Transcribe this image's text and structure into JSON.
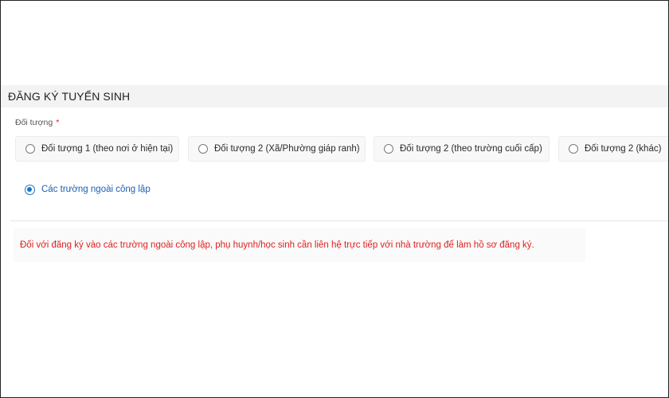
{
  "form": {
    "title": "ĐĂNG KÝ TUYỂN SINH",
    "field_label": "Đối tượng",
    "required_mark": "*",
    "options": [
      {
        "label": "Đối tượng 1 (theo nơi ở hiện tại)",
        "selected": false
      },
      {
        "label": "Đối tượng 2 (Xã/Phường giáp ranh)",
        "selected": false
      },
      {
        "label": "Đối tượng 2 (theo trường cuối cấp)",
        "selected": false
      },
      {
        "label": "Đối tượng 2 (khác)",
        "selected": false
      }
    ],
    "selected_option": {
      "label": "Các trường ngoài công lập",
      "selected": true
    },
    "notice": "Đối với đăng ký vào các trường ngoài công lập, phụ huynh/học sinh cần liên hệ trực tiếp với nhà trường để làm hồ sơ đăng ký."
  },
  "colors": {
    "accent": "#1a73c8",
    "notice": "#e01e1e",
    "required": "#e02020"
  }
}
